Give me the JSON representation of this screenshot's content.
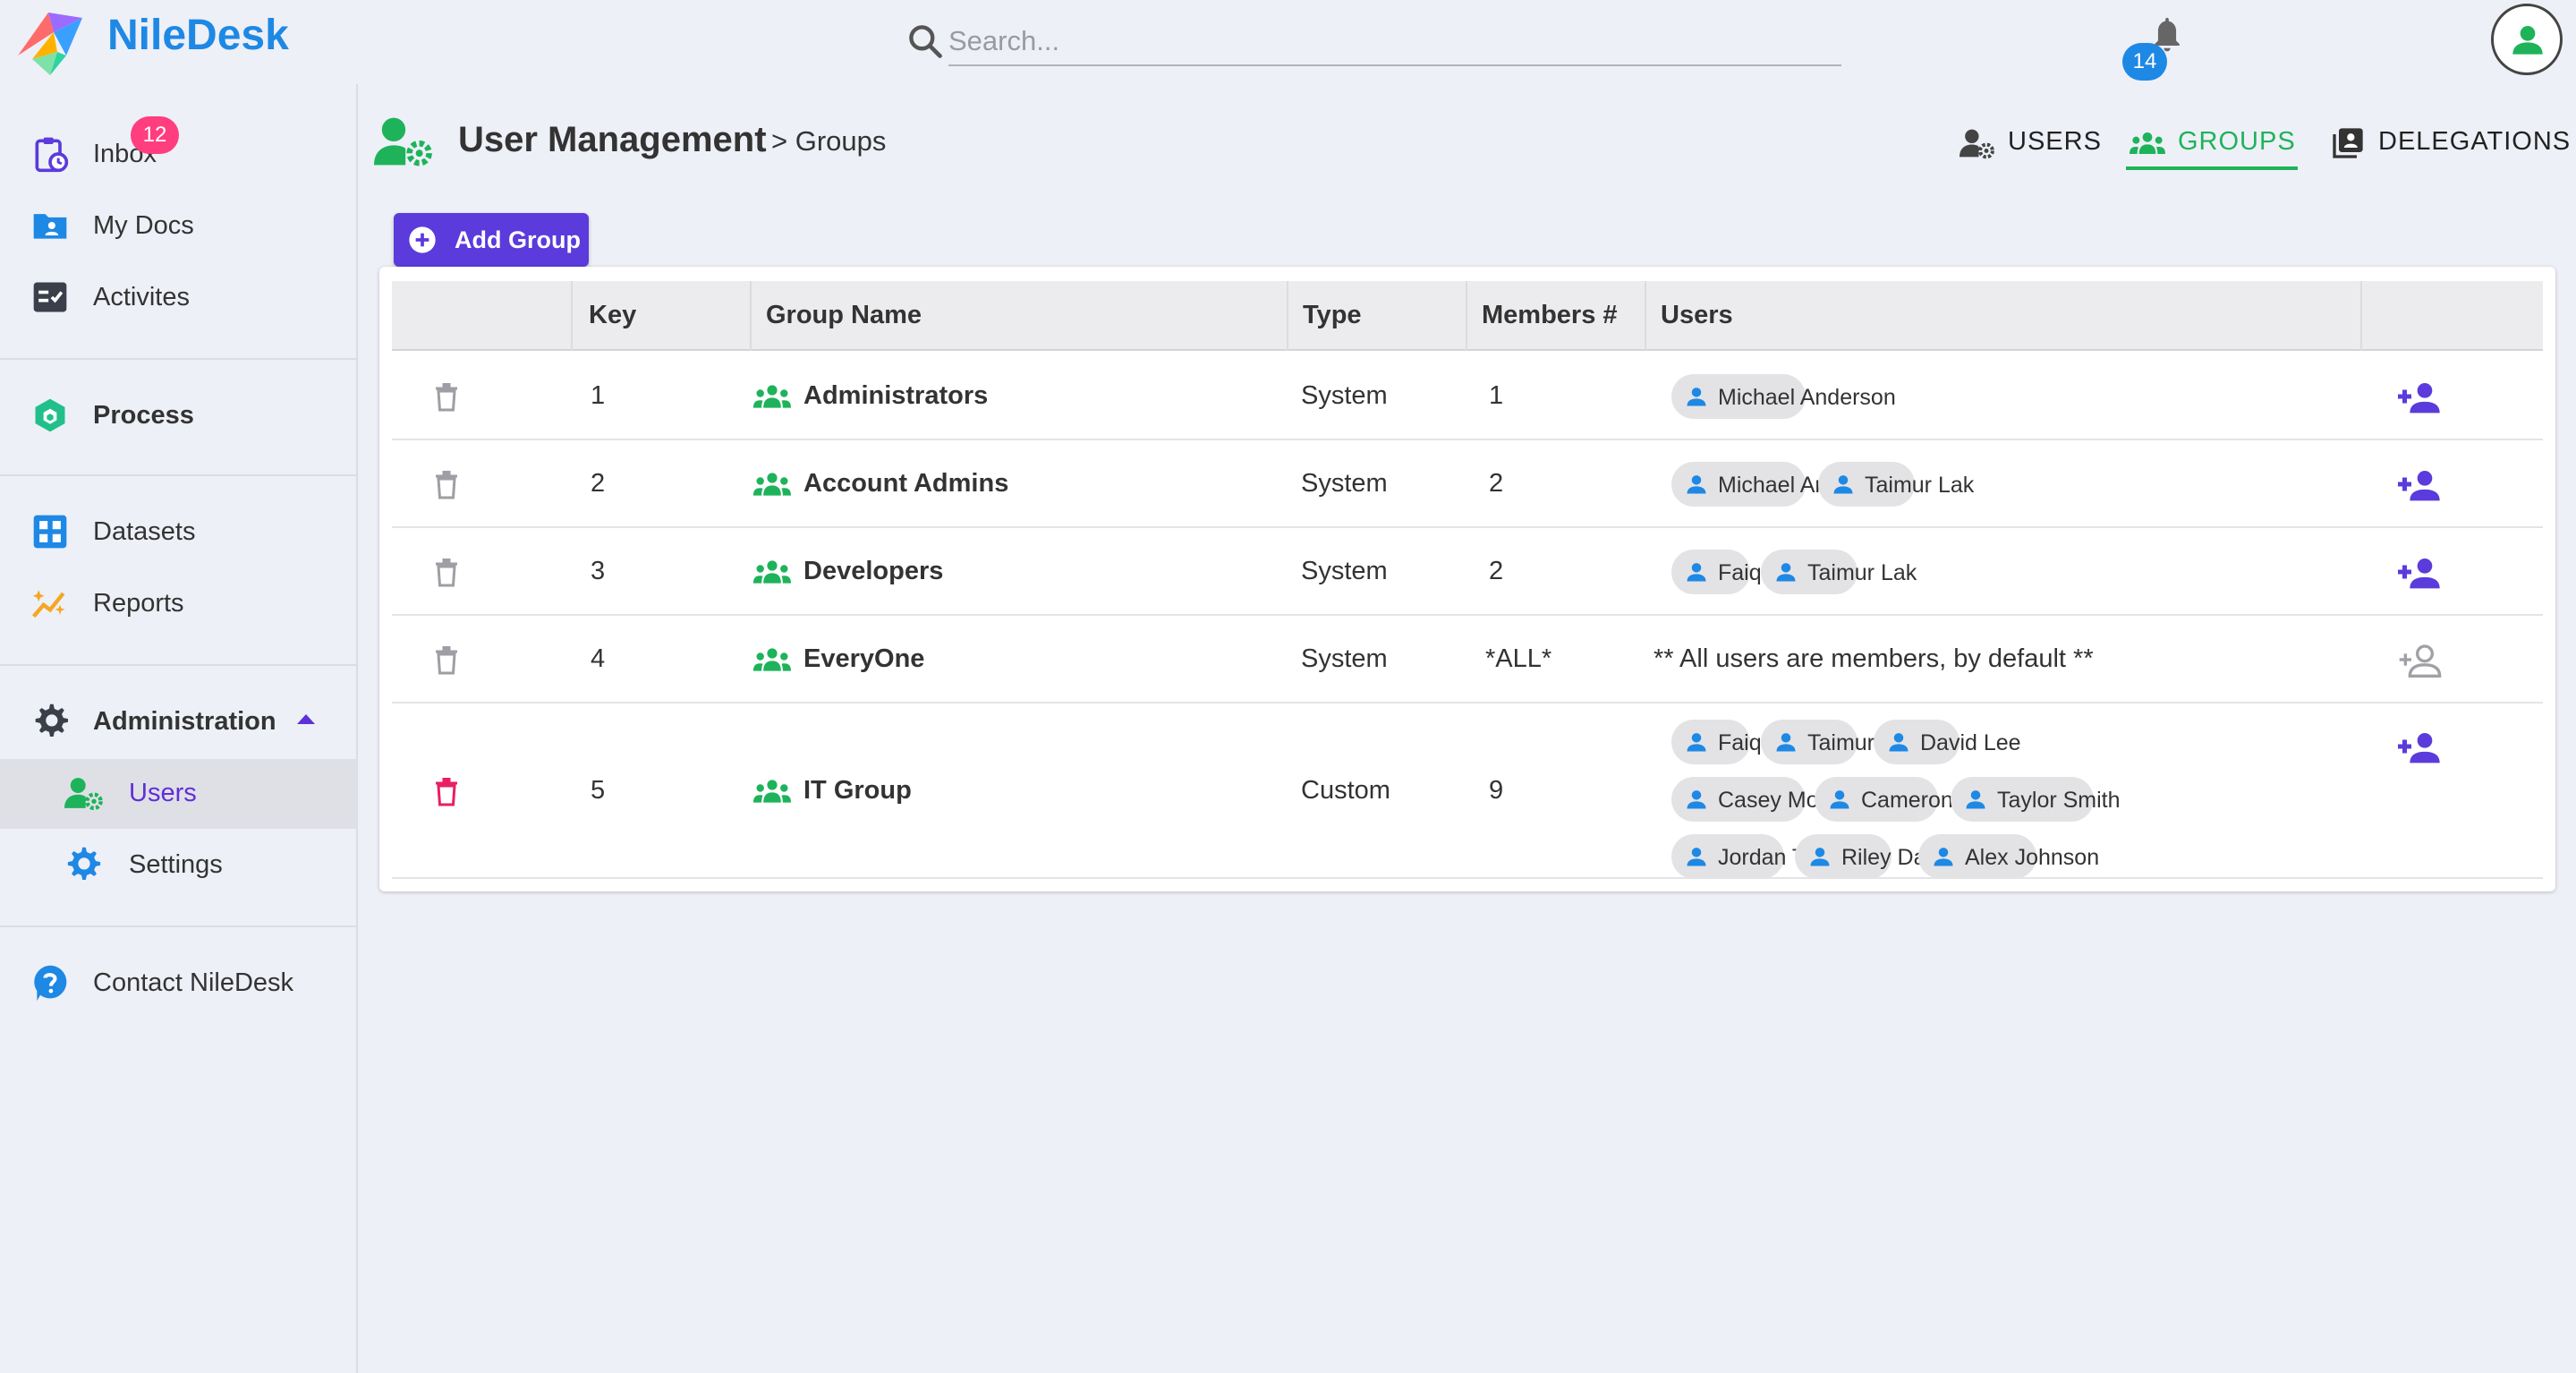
{
  "app": {
    "name": "NileDesk"
  },
  "search": {
    "placeholder": "Search..."
  },
  "notifications": {
    "count": "14"
  },
  "sidebar": {
    "inbox": {
      "label": "Inbox",
      "badge": "12"
    },
    "my_docs": "My Docs",
    "activities": "Activites",
    "process": "Process",
    "datasets": "Datasets",
    "reports": "Reports",
    "administration": "Administration",
    "users": "Users",
    "settings": "Settings",
    "contact": "Contact NileDesk"
  },
  "page": {
    "title": "User Management",
    "breadcrumb": "> Groups"
  },
  "tabs": [
    {
      "label": "USERS",
      "active": false
    },
    {
      "label": "GROUPS",
      "active": true
    },
    {
      "label": "DELEGATIONS",
      "active": false
    }
  ],
  "add_group_label": "Add Group",
  "table": {
    "headers": [
      "Key",
      "Group Name",
      "Type",
      "Members #",
      "Users"
    ],
    "rows": [
      {
        "key": "1",
        "name": "Administrators",
        "type": "System",
        "members": "1",
        "users": [
          "Michael Anderson"
        ],
        "note": "",
        "deletable": false,
        "can_add": true
      },
      {
        "key": "2",
        "name": "Account Admins",
        "type": "System",
        "members": "2",
        "users": [
          "Michael Anderson",
          "Taimur Lak"
        ],
        "note": "",
        "deletable": false,
        "can_add": true
      },
      {
        "key": "3",
        "name": "Developers",
        "type": "System",
        "members": "2",
        "users": [
          "Faiq Lak",
          "Taimur Lak"
        ],
        "note": "",
        "deletable": false,
        "can_add": true
      },
      {
        "key": "4",
        "name": "EveryOne",
        "type": "System",
        "members": "*ALL*",
        "users": [],
        "note": "** All users are members, by default **",
        "deletable": false,
        "can_add": false
      },
      {
        "key": "5",
        "name": "IT Group",
        "type": "Custom",
        "members": "9",
        "users": [
          "Faiq Lak",
          "Taimur Lak",
          "David Lee",
          "Casey Morgan",
          "Cameron Parker",
          "Taylor Smith",
          "Jordan Taylor",
          "Riley Davis",
          "Alex Johnson"
        ],
        "note": "",
        "deletable": true,
        "can_add": true
      }
    ]
  },
  "colors": {
    "brand": "#1e88e5",
    "primary": "#5b3bdb",
    "active_tab": "#1eb35a",
    "group_icon": "#1eb35a",
    "danger": "#e91e63",
    "badge_inbox": "#ff3d7f"
  },
  "icons": {
    "logo": "niledesk-logo",
    "search": "search-icon",
    "bell": "bell-icon",
    "account": "account-circle-icon",
    "group": "groups-icon",
    "trash": "trash-icon",
    "add_member": "person-add-icon",
    "user_chip": "person-icon"
  }
}
